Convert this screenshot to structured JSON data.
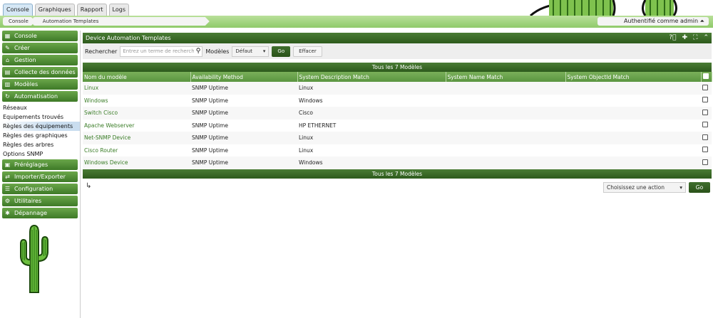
{
  "top_tabs": [
    {
      "label": "Console",
      "active": true
    },
    {
      "label": "Graphiques",
      "active": false
    },
    {
      "label": "Rapport",
      "active": false
    },
    {
      "label": "Logs",
      "active": false
    }
  ],
  "breadcrumb": [
    "Console",
    "Automation Templates"
  ],
  "auth_label": "Authentifié comme admin",
  "sidebar": {
    "menus_top": [
      {
        "label": "Console",
        "icon": "map-icon"
      },
      {
        "label": "Créer",
        "icon": "create-icon"
      },
      {
        "label": "Gestion",
        "icon": "home-icon"
      },
      {
        "label": "Collecte des données",
        "icon": "database-icon"
      },
      {
        "label": "Modèles",
        "icon": "template-icon"
      },
      {
        "label": "Automatisation",
        "icon": "refresh-icon"
      }
    ],
    "submenu": [
      {
        "label": "Réseaux",
        "selected": false
      },
      {
        "label": "Equipements trouvés",
        "selected": false
      },
      {
        "label": "Règles des équipements",
        "selected": true
      },
      {
        "label": "Règles des graphiques",
        "selected": false
      },
      {
        "label": "Règles des arbres",
        "selected": false
      },
      {
        "label": "Options SNMP",
        "selected": false
      }
    ],
    "menus_bottom": [
      {
        "label": "Préréglages",
        "icon": "presets-icon"
      },
      {
        "label": "Importer/Exporter",
        "icon": "import-export-icon"
      },
      {
        "label": "Configuration",
        "icon": "settings-icon"
      },
      {
        "label": "Utilitaires",
        "icon": "gears-icon"
      },
      {
        "label": "Dépannage",
        "icon": "bug-icon"
      }
    ]
  },
  "panel": {
    "title": "Device Automation Templates",
    "search_label": "Rechercher",
    "search_placeholder": "Entrez un terme de recherche",
    "models_label": "Modèles",
    "models_selected": "Défaut",
    "go_label": "Go",
    "clear_label": "Effacer"
  },
  "count_label": "Tous les 7 Modèles",
  "table": {
    "columns": [
      "Nom du modèle",
      "Availability Method",
      "System Description Match",
      "System Name Match",
      "System ObjectId Match"
    ],
    "rows": [
      {
        "name": "Linux",
        "method": "SNMP Uptime",
        "desc": "Linux",
        "sysname": "",
        "oid": ""
      },
      {
        "name": "Windows",
        "method": "SNMP Uptime",
        "desc": "Windows",
        "sysname": "",
        "oid": ""
      },
      {
        "name": "Switch Cisco",
        "method": "SNMP Uptime",
        "desc": "Cisco",
        "sysname": "",
        "oid": ""
      },
      {
        "name": "Apache Webserver",
        "method": "SNMP Uptime",
        "desc": "HP ETHERNET",
        "sysname": "",
        "oid": ""
      },
      {
        "name": "Net-SNMP Device",
        "method": "SNMP Uptime",
        "desc": "Linux",
        "sysname": "",
        "oid": ""
      },
      {
        "name": "Cisco Router",
        "method": "SNMP Uptime",
        "desc": "Linux",
        "sysname": "",
        "oid": ""
      },
      {
        "name": "Windows Device",
        "method": "SNMP Uptime",
        "desc": "Windows",
        "sysname": "",
        "oid": ""
      }
    ]
  },
  "action_select": "Choisissez une action",
  "action_go": "Go",
  "colors": {
    "brand_green": "#3e7a27",
    "link_green": "#3a7d27",
    "band_green": "#8fca6a"
  }
}
